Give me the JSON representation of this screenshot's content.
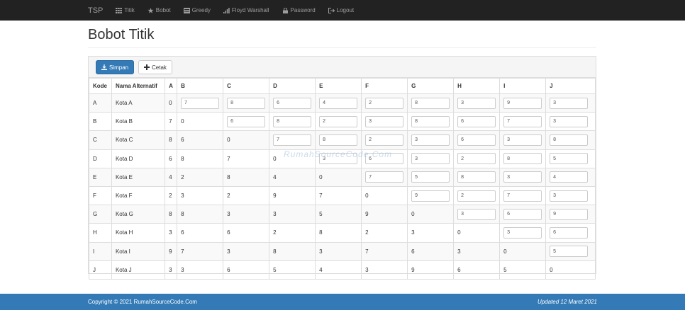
{
  "navbar": {
    "brand": "TSP",
    "items": [
      {
        "label": "Titik",
        "icon": "grid-icon"
      },
      {
        "label": "Bobot",
        "icon": "star-icon"
      },
      {
        "label": "Greedy",
        "icon": "list-icon"
      },
      {
        "label": "Floyd Warshall",
        "icon": "signal-icon"
      },
      {
        "label": "Password",
        "icon": "lock-icon"
      },
      {
        "label": "Logout",
        "icon": "logout-icon"
      }
    ]
  },
  "page": {
    "title": "Bobot Titik"
  },
  "toolbar": {
    "save_label": "Simpan",
    "print_label": "Cetak"
  },
  "table": {
    "headers": [
      "Kode",
      "Nama Alternatif",
      "A",
      "B",
      "C",
      "D",
      "E",
      "F",
      "G",
      "H",
      "I",
      "J"
    ],
    "rows": [
      {
        "kode": "A",
        "nama": "Kota A",
        "cells": [
          "0",
          "7",
          "8",
          "6",
          "4",
          "2",
          "8",
          "3",
          "9",
          "3"
        ]
      },
      {
        "kode": "B",
        "nama": "Kota B",
        "cells": [
          "7",
          "0",
          "6",
          "8",
          "2",
          "3",
          "8",
          "6",
          "7",
          "3"
        ]
      },
      {
        "kode": "C",
        "nama": "Kota C",
        "cells": [
          "8",
          "6",
          "0",
          "7",
          "8",
          "2",
          "3",
          "6",
          "3",
          "8"
        ]
      },
      {
        "kode": "D",
        "nama": "Kota D",
        "cells": [
          "6",
          "8",
          "7",
          "0",
          "3",
          "6",
          "3",
          "2",
          "8",
          "5"
        ]
      },
      {
        "kode": "E",
        "nama": "Kota E",
        "cells": [
          "4",
          "2",
          "8",
          "4",
          "0",
          "7",
          "5",
          "8",
          "3",
          "4"
        ]
      },
      {
        "kode": "F",
        "nama": "Kota F",
        "cells": [
          "2",
          "3",
          "2",
          "9",
          "7",
          "0",
          "9",
          "2",
          "7",
          "3"
        ]
      },
      {
        "kode": "G",
        "nama": "Kota G",
        "cells": [
          "8",
          "8",
          "3",
          "3",
          "5",
          "9",
          "0",
          "3",
          "6",
          "9"
        ]
      },
      {
        "kode": "H",
        "nama": "Kota H",
        "cells": [
          "3",
          "6",
          "6",
          "2",
          "8",
          "2",
          "3",
          "0",
          "3",
          "6"
        ]
      },
      {
        "kode": "I",
        "nama": "Kota I",
        "cells": [
          "9",
          "7",
          "3",
          "8",
          "3",
          "7",
          "6",
          "3",
          "0",
          "5"
        ]
      },
      {
        "kode": "J",
        "nama": "Kota J",
        "cells": [
          "3",
          "3",
          "6",
          "5",
          "4",
          "3",
          "9",
          "6",
          "5",
          "0"
        ]
      }
    ]
  },
  "watermark": "RumahSourceCode.Com",
  "footer": {
    "copyright": "Copyright © 2021 RumahSourceCode.Com",
    "updated": "Updated 12 Maret 2021"
  }
}
